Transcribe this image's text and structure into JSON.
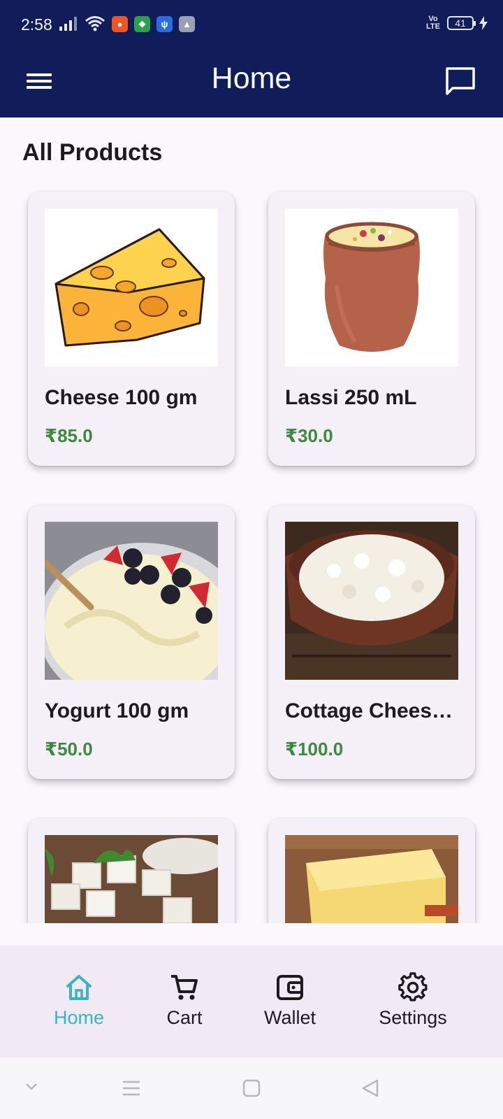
{
  "status_bar": {
    "time": "2:58",
    "network": "Vo LTE",
    "battery": "41",
    "icons": [
      "signal-icon",
      "wifi-icon",
      "location-app-icon",
      "shield-app-icon",
      "usb-icon",
      "drive-icon",
      "charging-icon"
    ]
  },
  "app_bar": {
    "title": "Home",
    "menu_icon": "menu-icon",
    "chat_icon": "chat-icon",
    "background": "#111d5a"
  },
  "section": {
    "title": "All Products"
  },
  "products": [
    {
      "name": "Cheese 100 gm",
      "price": "₹85.0",
      "image": "cheese-wedge-illustration"
    },
    {
      "name": "Lassi 250 mL",
      "price": "₹30.0",
      "image": "lassi-clay-cup-photo"
    },
    {
      "name": "Yogurt 100 gm",
      "price": "₹50.0",
      "image": "yogurt-berries-photo"
    },
    {
      "name": "Cottage Chees…",
      "price": "₹100.0",
      "image": "cottage-cheese-bowl-photo"
    },
    {
      "name": "",
      "price": "",
      "image": "paneer-cubes-photo"
    },
    {
      "name": "",
      "price": "",
      "image": "butter-block-photo"
    }
  ],
  "colors": {
    "price": "#3a8a40",
    "active_nav": "#38b4c5",
    "card_background": "#f5f0f7"
  },
  "bottom_nav": {
    "items": [
      {
        "label": "Home",
        "icon": "home-icon",
        "active": true
      },
      {
        "label": "Cart",
        "icon": "cart-icon",
        "active": false
      },
      {
        "label": "Wallet",
        "icon": "wallet-icon",
        "active": false
      },
      {
        "label": "Settings",
        "icon": "gear-icon",
        "active": false
      }
    ]
  },
  "system_nav": {
    "icons": [
      "chevron-down-icon",
      "recents-menu-icon",
      "home-square-icon",
      "back-triangle-icon"
    ]
  }
}
